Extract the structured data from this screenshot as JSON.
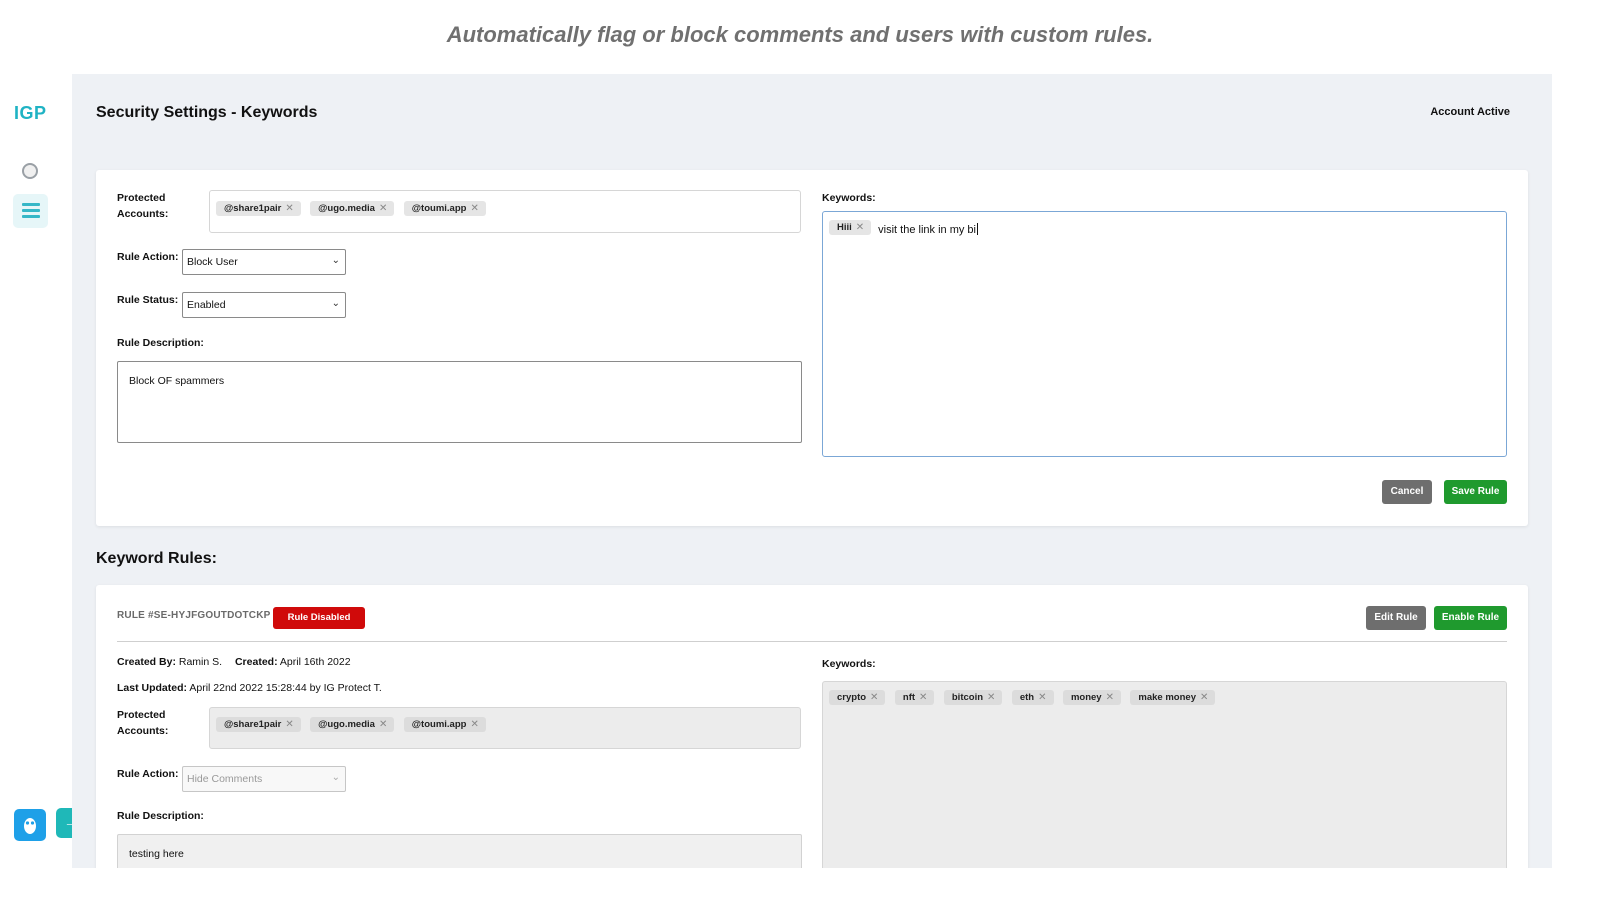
{
  "caption": "Automatically flag or block comments and users with custom rules.",
  "sidebar": {
    "logo": "IGP",
    "icons": [
      "circle-icon",
      "menu-icon"
    ],
    "bottom": {
      "owl": "owl-icon",
      "arrow": "→"
    }
  },
  "header": {
    "title": "Security Settings - Keywords",
    "status": "Account Active"
  },
  "form": {
    "protected_label": "Protected Accounts:",
    "protected_label_l1": "Protected",
    "protected_label_l2": "Accounts:",
    "accounts": [
      "@share1pair",
      "@ugo.media",
      "@toumi.app"
    ],
    "action_label": "Rule Action:",
    "action_value": "Block User",
    "status_label": "Rule Status:",
    "status_value": "Enabled",
    "description_label": "Rule Description:",
    "description_value": "Block OF spammers",
    "keywords_label": "Keywords:",
    "keywords": [
      "Hiii"
    ],
    "keyword_input": "visit the link in my bi",
    "cancel_label": "Cancel",
    "save_label": "Save Rule"
  },
  "rules_section": {
    "title": "Keyword Rules:"
  },
  "rule": {
    "id": "RULE #SE-HYJFGOUTDOTCKP",
    "badge": "Rule Disabled",
    "edit_label": "Edit Rule",
    "enable_label": "Enable Rule",
    "created_by_label": "Created By:",
    "created_by": "Ramin S.",
    "created_label": "Created:",
    "created": "April 16th 2022",
    "updated_label": "Last Updated:",
    "updated": "April 22nd 2022 15:28:44 by IG Protect T.",
    "protected_label_l1": "Protected",
    "protected_label_l2": "Accounts:",
    "accounts": [
      "@share1pair",
      "@ugo.media",
      "@toumi.app"
    ],
    "action_label": "Rule Action:",
    "action_value": "Hide Comments",
    "description_label": "Rule Description:",
    "description_value": "testing here",
    "keywords_label": "Keywords:",
    "keywords": [
      "crypto",
      "nft",
      "bitcoin",
      "eth",
      "money",
      "make money"
    ]
  },
  "colors": {
    "accent": "#1fb3c4",
    "save": "#1f9a2e",
    "disabled_badge": "#d00a0a",
    "neutral_button": "#6e6e6e"
  }
}
